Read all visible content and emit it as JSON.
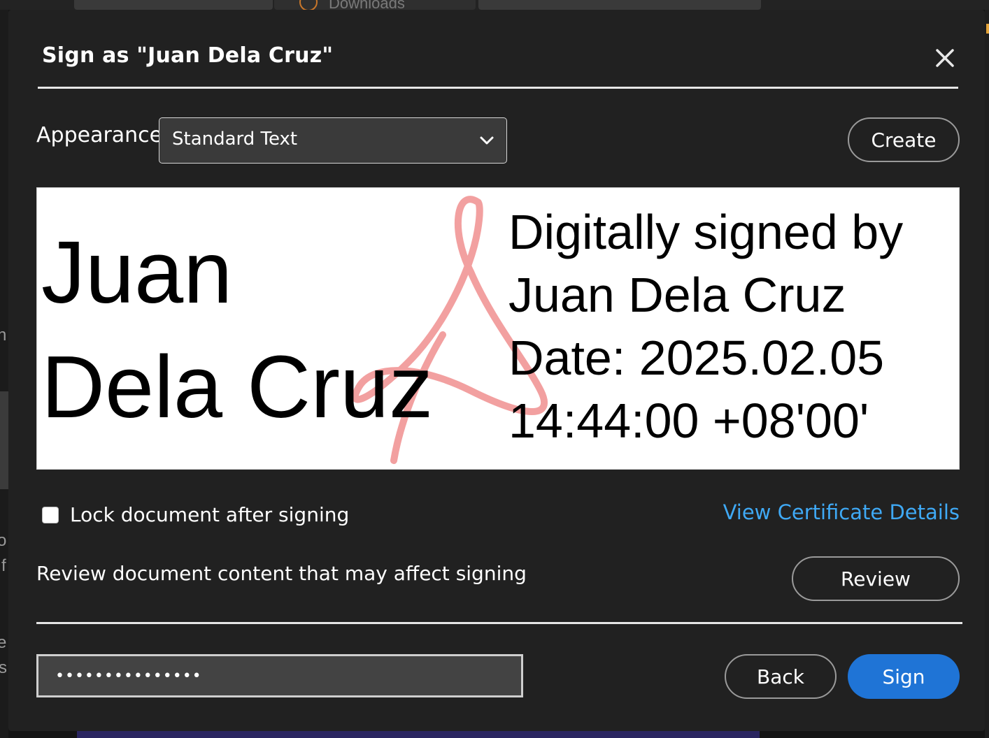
{
  "background": {
    "tab_label": "Downloads",
    "left_letters": [
      "n",
      "o",
      "f",
      "e",
      "s"
    ]
  },
  "dialog": {
    "title": "Sign as \"Juan Dela Cruz\"",
    "appearance_label": "Appearance",
    "appearance_selected": "Standard Text",
    "create_label": "Create",
    "preview": {
      "name_line_1": "Juan",
      "name_line_2": "Dela Cruz",
      "detail_line_1": "Digitally signed by",
      "detail_line_2": "Juan Dela Cruz",
      "detail_line_3": "Date: 2025.02.05",
      "detail_line_4": "14:44:00 +08'00'"
    },
    "lock_label": "Lock document after signing",
    "lock_checked": false,
    "certificate_link": "View Certificate Details",
    "review_text": "Review document content that may affect signing",
    "review_label": "Review",
    "password_value": "•••••••••••••••",
    "back_label": "Back",
    "sign_label": "Sign"
  },
  "colors": {
    "dialog_bg": "#212121",
    "accent_blue": "#1f74d6",
    "link_blue": "#3fa9f5",
    "acrobat_logo": "#f2a0a0"
  }
}
